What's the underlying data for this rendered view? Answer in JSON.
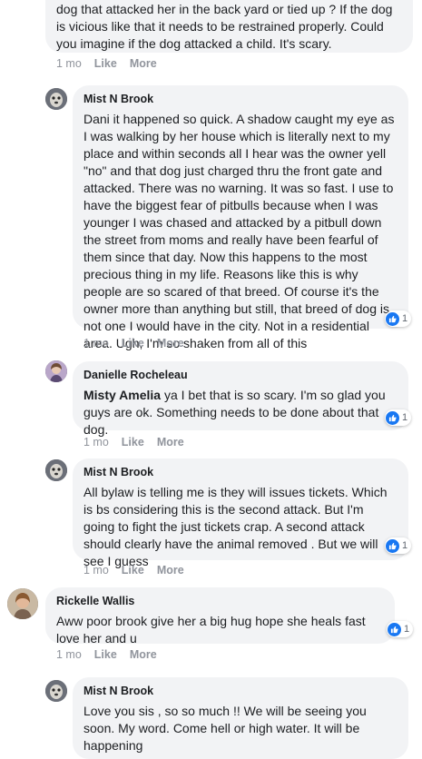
{
  "comments": [
    {
      "author": "",
      "text": "Oh he that's terrible. I'm glad she and you are ok. Was the dog that attacked her in the back yard or tied up ? If the dog is vicious like that it needs to be restrained properly. Could you imagine if the dog attacked a child. It's scary.",
      "time": "1 mo",
      "like": "Like",
      "more": "More"
    },
    {
      "author": "Mist N Brook",
      "text": "Dani it happened so quick. A shadow caught my eye as I was walking by her house which is literally next to my place and within seconds all I hear was the owner yell \"no\" and that dog just charged thru the front gate and attacked. There was no warning. It was so fast. I use to have the biggest fear of pitbulls because when I was younger I was chased and attacked by a pitbull down the street from moms and really have been fearful of them since that day. Now this happens to the most precious thing in my life. Reasons like this is why people are so scared of that breed. Of course it's the owner more than anything but still, that breed of dog is not one I would have in the city. Not in a residential area. Ugh, I'm so shaken from all of this",
      "reactions": "1",
      "time": "1 mo",
      "like": "Like",
      "more": "More"
    },
    {
      "author": "Danielle Rocheleau",
      "mention": "Misty Amelia",
      "text": " ya I bet that is so scary. I'm so glad you guys are ok. Something needs to be done about that dog.",
      "reactions": "1",
      "time": "1 mo",
      "like": "Like",
      "more": "More"
    },
    {
      "author": "Mist N Brook",
      "text": "All bylaw is telling me is they will issues tickets. Which is bs considering this is the second attack. But I'm going to fight the just tickets crap. A second attack should clearly have the animal removed . But we will see I guess",
      "reactions": "1",
      "time": "1 mo",
      "like": "Like",
      "more": "More"
    },
    {
      "author": "Rickelle Wallis",
      "text": "Aww poor brook give her a big hug hope she heals fast love her and u",
      "reactions": "1",
      "time": "1 mo",
      "like": "Like",
      "more": "More"
    },
    {
      "author": "Mist N Brook",
      "text": "Love you sis , so so much !! We will be seeing you soon. My word. Come hell or high water. It will be happening"
    }
  ],
  "colors": {
    "bubble": "#f2f3f5",
    "author": "#1c1e21",
    "meta": "#90949c",
    "like_blue": "#1877f2"
  }
}
